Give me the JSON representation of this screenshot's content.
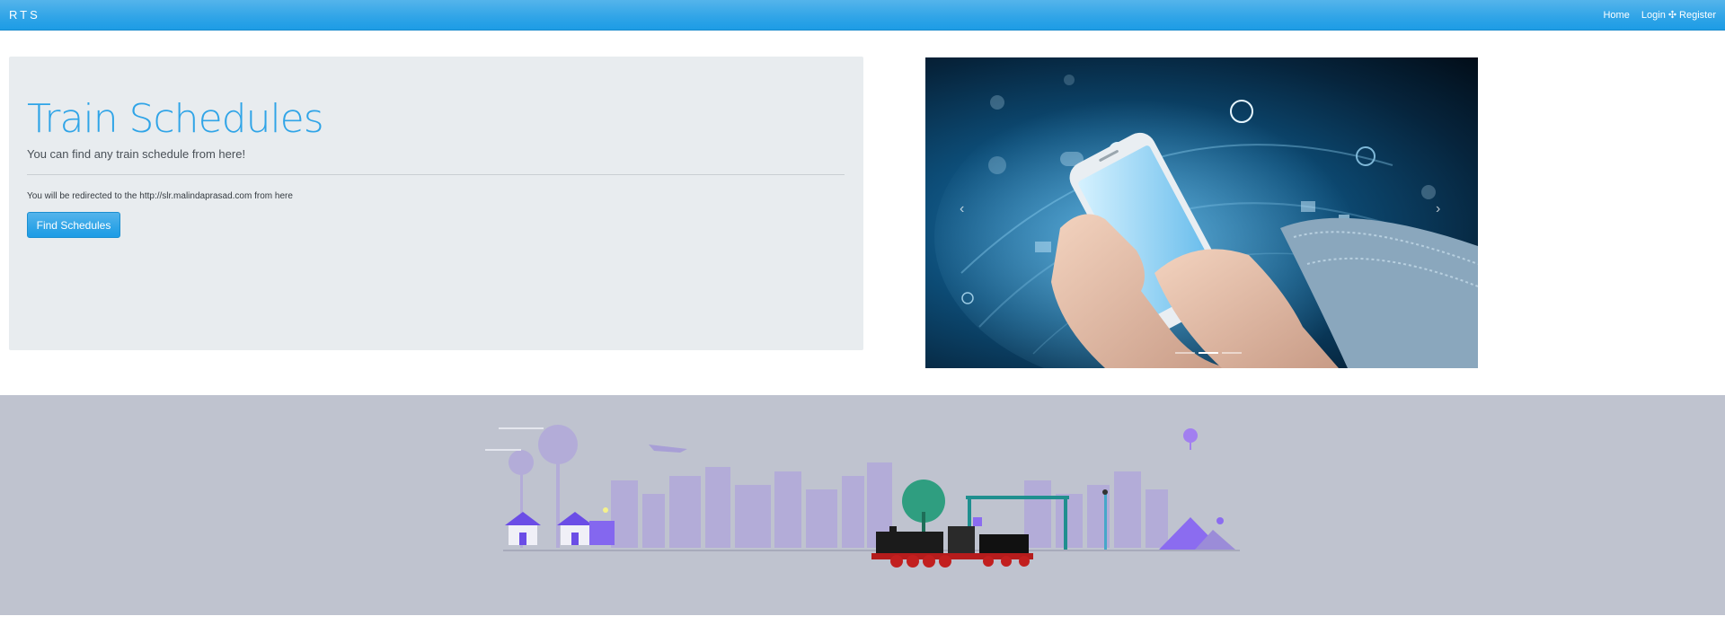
{
  "navbar": {
    "brand": "RTS",
    "links": {
      "home": "Home",
      "login": "Login",
      "separator": "✣",
      "register": "Register"
    }
  },
  "jumbotron": {
    "title": "Train Schedules",
    "lead": "You can find any train schedule from here!",
    "note": "You will be redirected to the http://slr.malindaprasad.com from here",
    "button_label": "Find Schedules"
  },
  "carousel": {
    "prev_icon": "chevron-left-icon",
    "next_icon": "chevron-right-icon",
    "slide_count": 3,
    "active_slide": 2
  },
  "colors": {
    "accent": "#2fa4e7",
    "jumbotron_bg": "#e8ecef",
    "footer_bg": "#bfc3cf"
  }
}
